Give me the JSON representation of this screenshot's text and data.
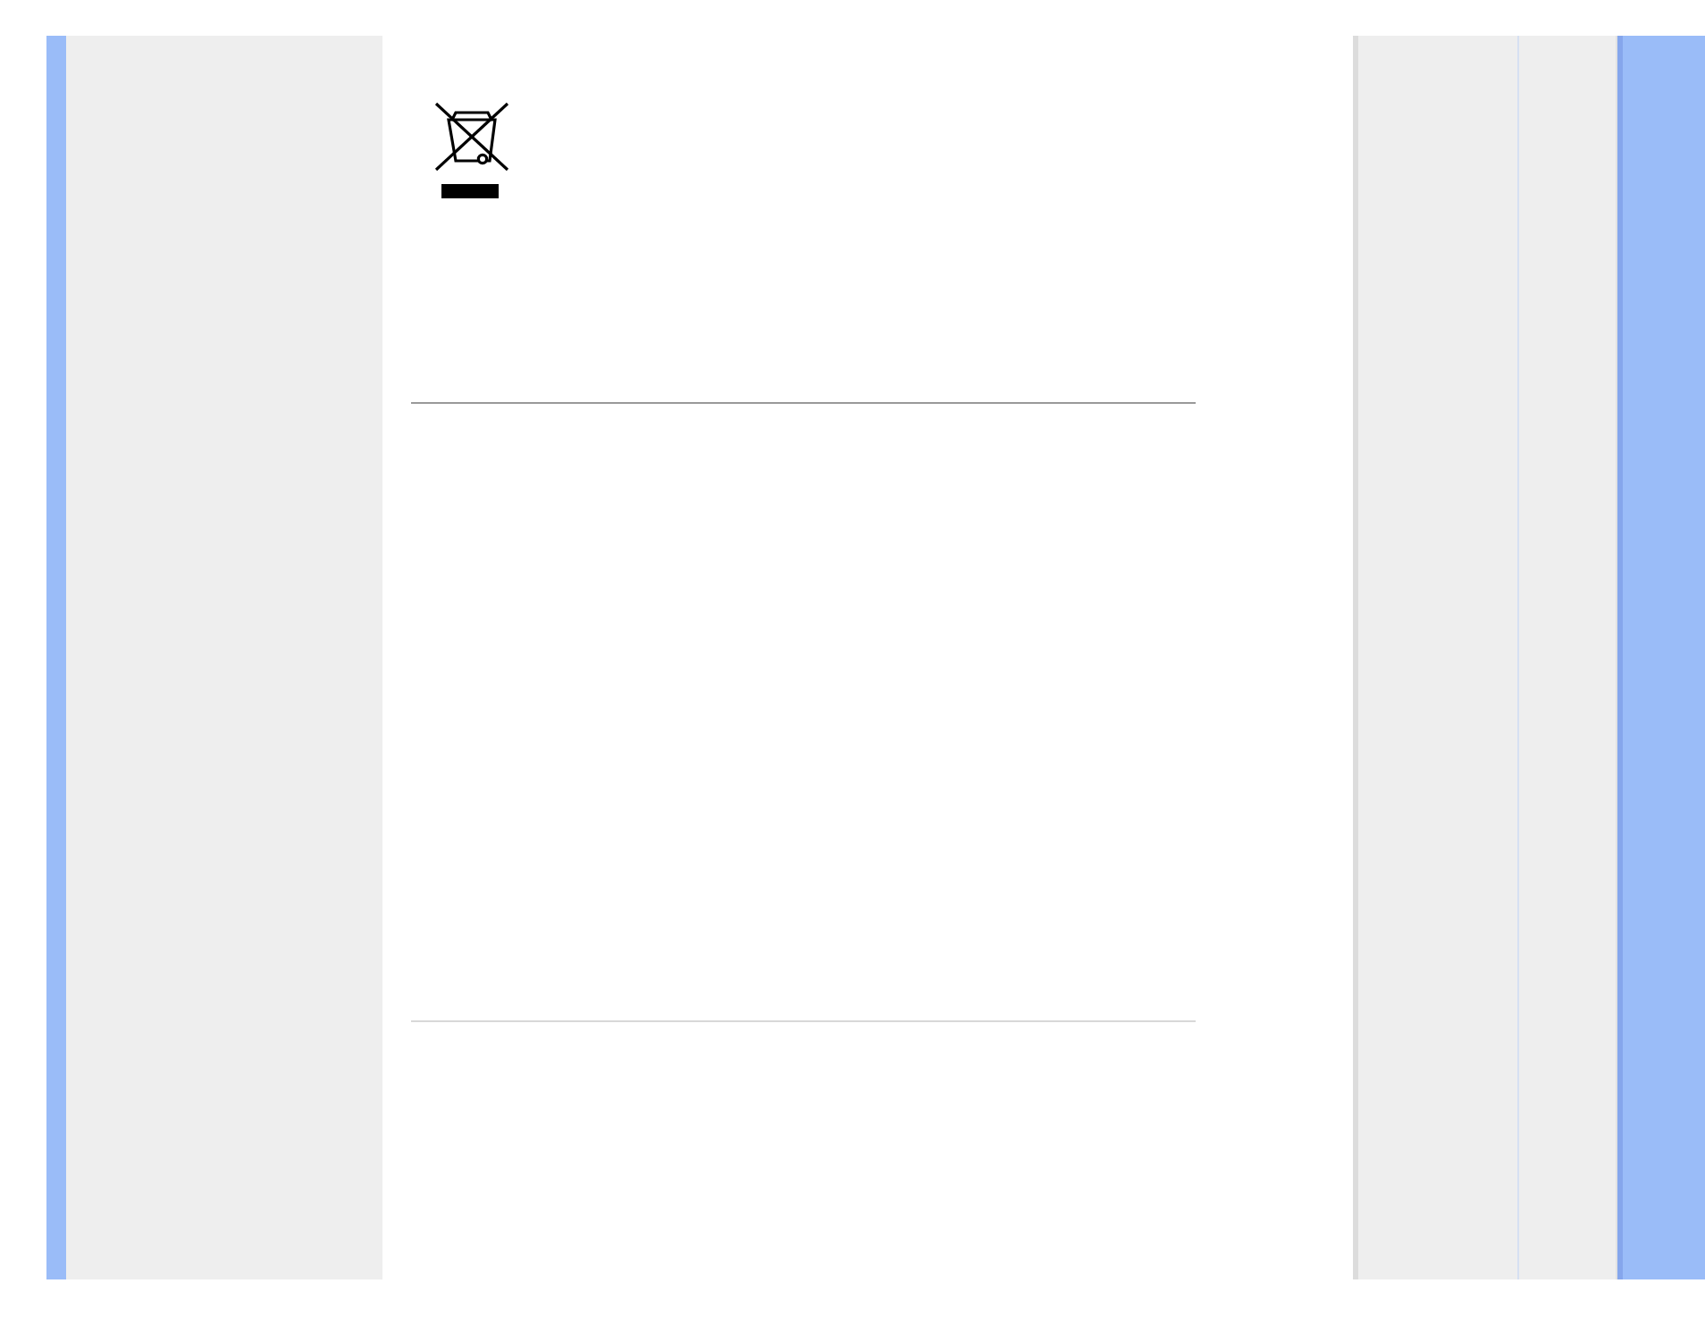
{
  "content": {
    "blocks": [
      {
        "kind": "recycle-symbol"
      },
      {
        "kind": "rule"
      },
      {
        "kind": "rule"
      }
    ]
  }
}
